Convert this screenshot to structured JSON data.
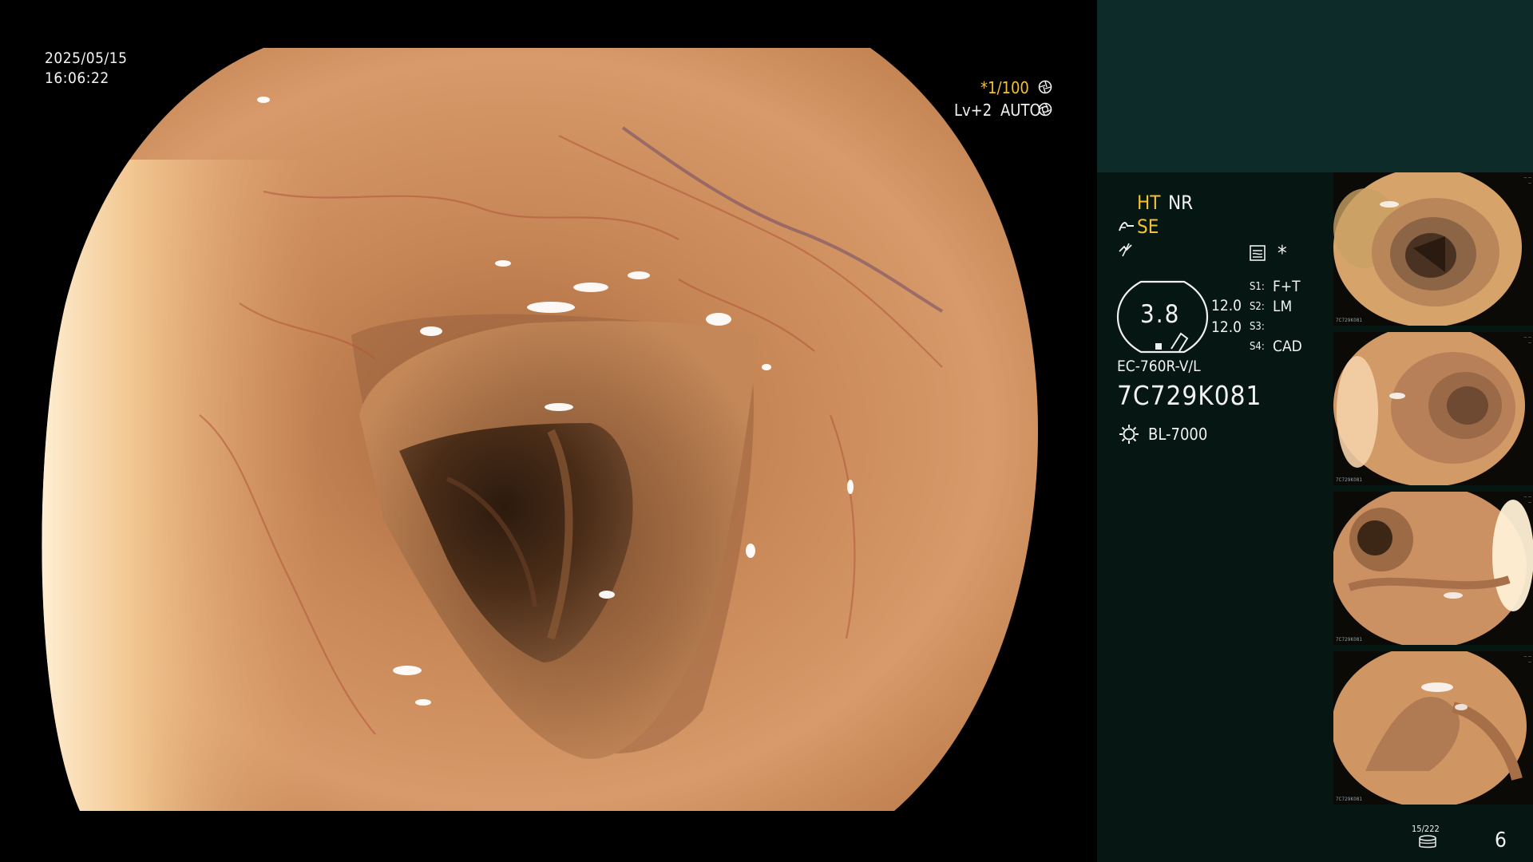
{
  "main_view": {
    "date": "2025/05/15",
    "time": "16:06:22",
    "shutter": "*1/100",
    "level": "Lv+2",
    "iris": "AUTO"
  },
  "panel": {
    "mode_ht": "HT",
    "mode_nr": "NR",
    "mode_se": "SE",
    "zoom_value": "3.8",
    "value_a": "12.0",
    "value_b": "12.0",
    "s1_label": "S1:",
    "s1_value": "F+T",
    "s2_label": "S2:",
    "s2_value": "LM",
    "s3_label": "S3:",
    "s3_value": "",
    "s4_label": "S4:",
    "s4_value": "CAD",
    "scope_model": "EC-760R-V/L",
    "scope_serial": "7C729K081",
    "light_source": "BL-7000",
    "storage_label": "15/222",
    "capture_count": "6",
    "asterisk": "*"
  },
  "thumbnails": [
    {
      "name": "capture-1"
    },
    {
      "name": "capture-2"
    },
    {
      "name": "capture-3"
    },
    {
      "name": "capture-4"
    }
  ],
  "colors": {
    "panel_bg": "#061613",
    "panel_top": "#0c2b29",
    "accent_yellow": "#f2c230",
    "mucosa": "#c98a5e"
  },
  "icons": [
    "shutter-icon",
    "iris-icon",
    "enhance-icon",
    "filter-icon",
    "image-mode-icon",
    "lamp-icon",
    "storage-icon"
  ]
}
